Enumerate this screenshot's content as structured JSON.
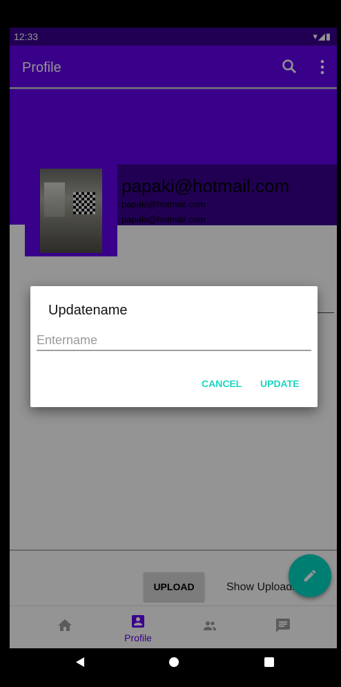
{
  "status_bar": {
    "time": "12:33",
    "icons": "▾◢▮"
  },
  "app_bar": {
    "title": "Profile"
  },
  "profile": {
    "email_main": "papaki@hotmail.com",
    "email_line1": "papaki@hotmail.com",
    "email_line2": "papaki@hotmail.com"
  },
  "actions": {
    "upload_label": "UPLOAD",
    "show_uploads_label": "Show Uploads"
  },
  "dialog": {
    "title": "Updatename",
    "input_placeholder": "Entername",
    "input_value": "",
    "cancel_label": "CANCEL",
    "update_label": "UPDATE"
  },
  "bottom_nav": {
    "profile_label": "Profile",
    "items": [
      "home-icon",
      "profile-icon",
      "people-icon",
      "chat-icon"
    ],
    "active": "profile"
  },
  "colors": {
    "primary": "#6200ee",
    "primary_dark": "#3a0191",
    "accent": "#03dac5"
  }
}
